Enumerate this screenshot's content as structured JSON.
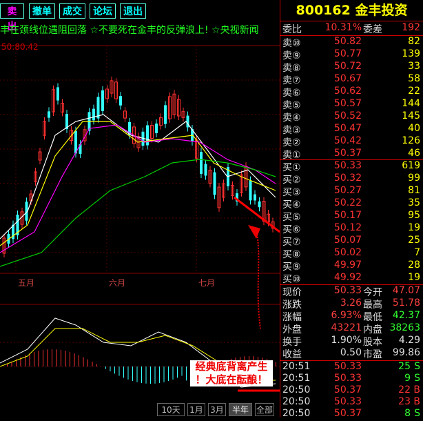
{
  "toolbar": {
    "buttons": [
      "卖出",
      "撤单",
      "成交",
      "论坛",
      "退出"
    ]
  },
  "ticker": "丰在颈线位遇阻回落 ☆不要死在金丰的反弹浪上! ☆央视新闻",
  "chart": {
    "price_label": "50:80.42",
    "months": [
      "五月",
      "六月",
      "七月"
    ],
    "annotation": [
      "经典底背离产生",
      "！大底在酝酿！"
    ]
  },
  "bottom_tabs": [
    "10天",
    "1月",
    "3月",
    "半年",
    "全部"
  ],
  "panel": {
    "code": "800162",
    "name": "金丰投资",
    "weibi_label": "委比",
    "weibi_value": "10.31%",
    "weicha_label": "委差",
    "weicha_value": "192",
    "asks": [
      {
        "label": "卖⑩",
        "price": "50.82",
        "vol": "82"
      },
      {
        "label": "卖⑨",
        "price": "50.77",
        "vol": "139"
      },
      {
        "label": "卖⑧",
        "price": "50.72",
        "vol": "33"
      },
      {
        "label": "卖⑦",
        "price": "50.67",
        "vol": "58"
      },
      {
        "label": "卖⑥",
        "price": "50.62",
        "vol": "22"
      },
      {
        "label": "卖⑤",
        "price": "50.57",
        "vol": "144"
      },
      {
        "label": "卖④",
        "price": "50.52",
        "vol": "145"
      },
      {
        "label": "卖③",
        "price": "50.47",
        "vol": "40"
      },
      {
        "label": "卖②",
        "price": "50.42",
        "vol": "126"
      },
      {
        "label": "卖①",
        "price": "50.37",
        "vol": "46"
      }
    ],
    "bids": [
      {
        "label": "买①",
        "price": "50.33",
        "vol": "619"
      },
      {
        "label": "买②",
        "price": "50.32",
        "vol": "99"
      },
      {
        "label": "买③",
        "price": "50.27",
        "vol": "81"
      },
      {
        "label": "买④",
        "price": "50.22",
        "vol": "35"
      },
      {
        "label": "买⑤",
        "price": "50.17",
        "vol": "95"
      },
      {
        "label": "买⑥",
        "price": "50.12",
        "vol": "19"
      },
      {
        "label": "买⑦",
        "price": "50.07",
        "vol": "25"
      },
      {
        "label": "买⑧",
        "price": "50.02",
        "vol": "7"
      },
      {
        "label": "买⑨",
        "price": "49.97",
        "vol": "28"
      },
      {
        "label": "买⑩",
        "price": "49.92",
        "vol": "19"
      }
    ],
    "quote": [
      {
        "l1": "现价",
        "v1": "50.33",
        "l2": "今开",
        "v2": "47.07",
        "c1": "#ff4040",
        "c2": "#ff4040"
      },
      {
        "l1": "涨跌",
        "v1": "3.26",
        "l2": "最高",
        "v2": "51.78",
        "c1": "#ff4040",
        "c2": "#ff4040"
      },
      {
        "l1": "涨幅",
        "v1": "6.93%",
        "l2": "最低",
        "v2": "42.37",
        "c1": "#ff4040",
        "c2": "#33ff33"
      },
      {
        "l1": "外盘",
        "v1": "43221",
        "l2": "内盘",
        "v2": "38263",
        "c1": "#ff4040",
        "c2": "#33ff33"
      },
      {
        "l1": "换手",
        "v1": "1.90%",
        "l2": "股本",
        "v2": "4.29",
        "c1": "#dddddd",
        "c2": "#dddddd"
      },
      {
        "l1": "收益",
        "v1": "0.50",
        "l2": "市盈",
        "v2": "99.86",
        "c1": "#dddddd",
        "c2": "#dddddd"
      }
    ],
    "trades": [
      {
        "time": "20:51",
        "price": "50.33",
        "vol": "25",
        "flag": "S"
      },
      {
        "time": "20:51",
        "price": "50.33",
        "vol": "9",
        "flag": "S"
      },
      {
        "time": "20:50",
        "price": "50.37",
        "vol": "22",
        "flag": "B"
      },
      {
        "time": "20:50",
        "price": "50.33",
        "vol": "23",
        "flag": "B"
      },
      {
        "time": "20:50",
        "price": "50.37",
        "vol": "8",
        "flag": "S"
      }
    ]
  },
  "colors": {
    "up": "#ff3030",
    "down": "#33ffff",
    "ma5": "#ffffff",
    "ma10": "#ffff00",
    "ma20": "#ff00ff",
    "ma60": "#00cc00"
  }
}
